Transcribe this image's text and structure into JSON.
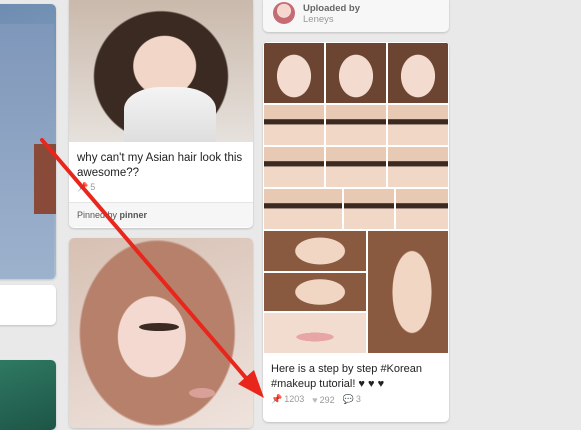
{
  "cards": {
    "card1": {
      "description": "why can't my Asian hair look this awesome??",
      "repins": "5",
      "pinned_by_label": "Pinned by",
      "pinned_by_user": "pinner"
    },
    "card3": {
      "uploaded_by_label": "Uploaded by",
      "uploader": "Leneys",
      "description": "Here is a step by step #Korean #makeup tutorial! ♥ ♥ ♥",
      "repins": "1203",
      "likes": "292",
      "comments": "3"
    }
  },
  "annotation": {
    "color": "#e8261c"
  },
  "icons": {
    "repin": "pin-icon",
    "like": "heart-icon",
    "comment": "comment-icon"
  }
}
